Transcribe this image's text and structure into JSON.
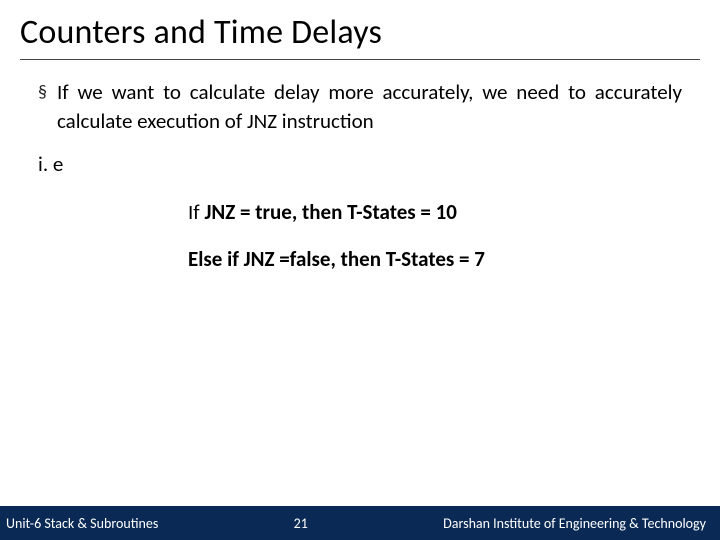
{
  "slide": {
    "title": "Counters and Time Delays",
    "bullet": "If we want to calculate delay more accurately, we need to accurately calculate execution of JNZ instruction",
    "ie": "i. e",
    "cond_true_prefix": "If ",
    "cond_true_mid": "JNZ = true",
    "cond_true_suffix": ", then T-States = 10",
    "cond_false_prefix": "Else if ",
    "cond_false_mid": "JNZ =false",
    "cond_false_suffix": ", then T-States = 7"
  },
  "footer": {
    "left": "Unit-6 Stack & Subroutines",
    "page": "21",
    "right": "Darshan Institute of Engineering & Technology"
  }
}
